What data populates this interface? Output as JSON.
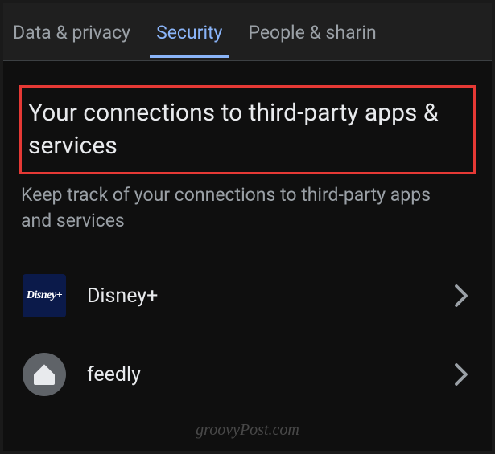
{
  "tabs": {
    "data_privacy": "Data & privacy",
    "security": "Security",
    "people_sharing": "People & sharin"
  },
  "section": {
    "title": "Your connections to third-party apps & services",
    "subtitle": "Keep track of your connections to third-party apps and services"
  },
  "apps": {
    "disney": {
      "label": "Disney+",
      "icon_text": "Disney+"
    },
    "feedly": {
      "label": "feedly"
    }
  },
  "watermark": "groovyPost.com"
}
